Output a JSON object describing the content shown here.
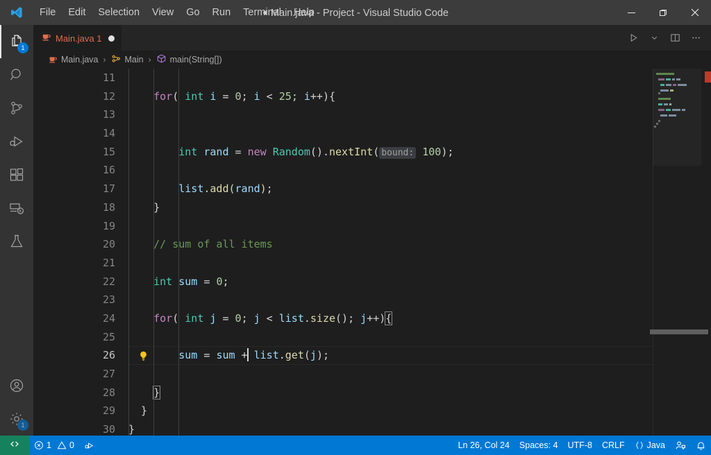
{
  "window": {
    "title": "Main.java - Project - Visual Studio Code",
    "dirty_marker": "●",
    "minimize_icon": "minimize-icon",
    "maximize_icon": "maximize-icon",
    "close_icon": "close-icon"
  },
  "menubar": {
    "items": [
      {
        "label": "File"
      },
      {
        "label": "Edit"
      },
      {
        "label": "Selection"
      },
      {
        "label": "View"
      },
      {
        "label": "Go"
      },
      {
        "label": "Run"
      },
      {
        "label": "Terminal"
      },
      {
        "label": "Help"
      }
    ]
  },
  "activitybar": {
    "items": [
      {
        "name": "explorer",
        "icon": "files-icon",
        "badge": "1",
        "active": true
      },
      {
        "name": "search",
        "icon": "search-icon",
        "badge": "",
        "active": false
      },
      {
        "name": "source-control",
        "icon": "source-control-icon",
        "badge": "",
        "active": false
      },
      {
        "name": "run-and-debug",
        "icon": "run-debug-icon",
        "badge": "",
        "active": false
      },
      {
        "name": "extensions",
        "icon": "extensions-icon",
        "badge": "",
        "active": false
      },
      {
        "name": "remote-explorer",
        "icon": "remote-explorer-icon",
        "badge": "",
        "active": false
      },
      {
        "name": "testing",
        "icon": "beaker-icon",
        "badge": "",
        "active": false
      },
      {
        "name": "accounts",
        "icon": "account-icon",
        "badge": "",
        "active": false
      },
      {
        "name": "settings",
        "icon": "gear-icon",
        "badge": "1",
        "active": false
      }
    ]
  },
  "tabs": {
    "open": [
      {
        "label": "Main.java 1",
        "icon": "java-file-icon",
        "dirty": true
      }
    ],
    "actions": [
      {
        "name": "run-code",
        "icon": "play-icon"
      },
      {
        "name": "run-options",
        "icon": "chevron-down-icon"
      },
      {
        "name": "split-editor",
        "icon": "split-editor-icon"
      },
      {
        "name": "more-actions",
        "icon": "ellipsis-icon"
      }
    ]
  },
  "breadcrumbs": {
    "parts": [
      {
        "label": "Main.java",
        "icon": "java-file-icon"
      },
      {
        "label": "Main",
        "icon": "class-icon"
      },
      {
        "label": "main(String[])",
        "icon": "method-icon"
      }
    ],
    "separator": "›"
  },
  "editor": {
    "language": "java",
    "first_visible_line": 11,
    "current_line": 26,
    "lines": [
      {
        "n": "11",
        "tokens": []
      },
      {
        "n": "12",
        "tokens": [
          {
            "t": "    ",
            "c": "pn"
          },
          {
            "t": "for",
            "c": "kw"
          },
          {
            "t": "( ",
            "c": "pn"
          },
          {
            "t": "int",
            "c": "type"
          },
          {
            "t": " ",
            "c": "pn"
          },
          {
            "t": "i",
            "c": "var"
          },
          {
            "t": " = ",
            "c": "pn"
          },
          {
            "t": "0",
            "c": "num"
          },
          {
            "t": "; ",
            "c": "pn"
          },
          {
            "t": "i",
            "c": "var"
          },
          {
            "t": " < ",
            "c": "pn"
          },
          {
            "t": "25",
            "c": "num"
          },
          {
            "t": "; ",
            "c": "pn"
          },
          {
            "t": "i",
            "c": "var"
          },
          {
            "t": "++){",
            "c": "pn"
          }
        ]
      },
      {
        "n": "13",
        "tokens": []
      },
      {
        "n": "14",
        "tokens": []
      },
      {
        "n": "15",
        "tokens": [
          {
            "t": "        ",
            "c": "pn"
          },
          {
            "t": "int",
            "c": "type"
          },
          {
            "t": " ",
            "c": "pn"
          },
          {
            "t": "rand",
            "c": "var"
          },
          {
            "t": " = ",
            "c": "pn"
          },
          {
            "t": "new",
            "c": "kw"
          },
          {
            "t": " ",
            "c": "pn"
          },
          {
            "t": "Random",
            "c": "type"
          },
          {
            "t": "().",
            "c": "pn"
          },
          {
            "t": "nextInt",
            "c": "fn"
          },
          {
            "t": "(",
            "c": "pn"
          },
          {
            "t": "bound:",
            "c": "hint"
          },
          {
            "t": " ",
            "c": "pn"
          },
          {
            "t": "100",
            "c": "num"
          },
          {
            "t": ");",
            "c": "pn"
          }
        ]
      },
      {
        "n": "16",
        "tokens": []
      },
      {
        "n": "17",
        "tokens": [
          {
            "t": "        ",
            "c": "pn"
          },
          {
            "t": "list",
            "c": "var"
          },
          {
            "t": ".",
            "c": "pn"
          },
          {
            "t": "add",
            "c": "fn"
          },
          {
            "t": "(",
            "c": "pn"
          },
          {
            "t": "rand",
            "c": "var"
          },
          {
            "t": ");",
            "c": "pn"
          }
        ]
      },
      {
        "n": "18",
        "tokens": [
          {
            "t": "    }",
            "c": "pn"
          }
        ]
      },
      {
        "n": "19",
        "tokens": []
      },
      {
        "n": "20",
        "tokens": [
          {
            "t": "    // sum of all items",
            "c": "cmt"
          }
        ]
      },
      {
        "n": "21",
        "tokens": []
      },
      {
        "n": "22",
        "tokens": [
          {
            "t": "    ",
            "c": "pn"
          },
          {
            "t": "int",
            "c": "type"
          },
          {
            "t": " ",
            "c": "pn"
          },
          {
            "t": "sum",
            "c": "var"
          },
          {
            "t": " = ",
            "c": "pn"
          },
          {
            "t": "0",
            "c": "num"
          },
          {
            "t": ";",
            "c": "pn"
          }
        ]
      },
      {
        "n": "23",
        "tokens": []
      },
      {
        "n": "24",
        "tokens": [
          {
            "t": "    ",
            "c": "pn"
          },
          {
            "t": "for",
            "c": "kw"
          },
          {
            "t": "( ",
            "c": "pn"
          },
          {
            "t": "int",
            "c": "type"
          },
          {
            "t": " ",
            "c": "pn"
          },
          {
            "t": "j",
            "c": "var"
          },
          {
            "t": " = ",
            "c": "pn"
          },
          {
            "t": "0",
            "c": "num"
          },
          {
            "t": "; ",
            "c": "pn"
          },
          {
            "t": "j",
            "c": "var"
          },
          {
            "t": " < ",
            "c": "pn"
          },
          {
            "t": "list",
            "c": "var"
          },
          {
            "t": ".",
            "c": "pn"
          },
          {
            "t": "size",
            "c": "fn"
          },
          {
            "t": "(); ",
            "c": "pn"
          },
          {
            "t": "j",
            "c": "var"
          },
          {
            "t": "++)",
            "c": "pn"
          },
          {
            "t": "{",
            "c": "pn bracket-match"
          }
        ]
      },
      {
        "n": "25",
        "tokens": []
      },
      {
        "n": "26",
        "tokens": [
          {
            "t": "        ",
            "c": "pn"
          },
          {
            "t": "sum",
            "c": "var"
          },
          {
            "t": " = ",
            "c": "pn"
          },
          {
            "t": "sum",
            "c": "var"
          },
          {
            "t": " +",
            "c": "pn"
          },
          {
            "t": "__CURSOR__",
            "c": "cursor"
          },
          {
            "t": " ",
            "c": "pn"
          },
          {
            "t": "list",
            "c": "var"
          },
          {
            "t": ".",
            "c": "pn"
          },
          {
            "t": "get",
            "c": "fn"
          },
          {
            "t": "(",
            "c": "pn"
          },
          {
            "t": "j",
            "c": "var"
          },
          {
            "t": ");",
            "c": "pn"
          }
        ]
      },
      {
        "n": "27",
        "tokens": []
      },
      {
        "n": "28",
        "tokens": [
          {
            "t": "    ",
            "c": "pn"
          },
          {
            "t": "}",
            "c": "pn bracket-match"
          }
        ]
      },
      {
        "n": "29",
        "tokens": [
          {
            "t": "  }",
            "c": "pn"
          }
        ]
      },
      {
        "n": "30",
        "tokens": [
          {
            "t": "}",
            "c": "pn"
          }
        ]
      }
    ],
    "lightbulb": {
      "line": 26,
      "icon": "lightbulb-icon"
    }
  },
  "minimap": {
    "rows": [
      {
        "indent": 1,
        "segs": [
          {
            "w": 26,
            "color": "#6a9955"
          }
        ]
      },
      {
        "indent": 0,
        "segs": []
      },
      {
        "indent": 2,
        "segs": [
          {
            "w": 9,
            "color": "#9b6fa0"
          },
          {
            "w": 7,
            "color": "#4ec9b0"
          },
          {
            "w": 4,
            "color": "#8aa0b5"
          },
          {
            "w": 6,
            "color": "#8aa0b5"
          }
        ]
      },
      {
        "indent": 0,
        "segs": []
      },
      {
        "indent": 3,
        "segs": [
          {
            "w": 6,
            "color": "#4ec9b0"
          },
          {
            "w": 8,
            "color": "#8aa0b5"
          },
          {
            "w": 5,
            "color": "#9b6fa0"
          },
          {
            "w": 13,
            "color": "#8aa0b5"
          }
        ]
      },
      {
        "indent": 0,
        "segs": []
      },
      {
        "indent": 3,
        "segs": [
          {
            "w": 12,
            "color": "#8aa0b5"
          },
          {
            "w": 5,
            "color": "#c4c48b"
          }
        ]
      },
      {
        "indent": 2,
        "segs": [
          {
            "w": 3,
            "color": "#777777"
          }
        ]
      },
      {
        "indent": 0,
        "segs": []
      },
      {
        "indent": 2,
        "segs": [
          {
            "w": 18,
            "color": "#6a9955"
          }
        ]
      },
      {
        "indent": 0,
        "segs": []
      },
      {
        "indent": 2,
        "segs": [
          {
            "w": 6,
            "color": "#4ec9b0"
          },
          {
            "w": 6,
            "color": "#8aa0b5"
          },
          {
            "w": 3,
            "color": "#b5cea8"
          }
        ]
      },
      {
        "indent": 0,
        "segs": []
      },
      {
        "indent": 2,
        "segs": [
          {
            "w": 9,
            "color": "#9b6fa0"
          },
          {
            "w": 7,
            "color": "#4ec9b0"
          },
          {
            "w": 12,
            "color": "#8aa0b5"
          },
          {
            "w": 5,
            "color": "#8aa0b5"
          }
        ]
      },
      {
        "indent": 0,
        "segs": []
      },
      {
        "indent": 3,
        "segs": [
          {
            "w": 10,
            "color": "#8aa0b5"
          },
          {
            "w": 11,
            "color": "#8aa0b5"
          }
        ]
      },
      {
        "indent": 0,
        "segs": []
      },
      {
        "indent": 2,
        "segs": [
          {
            "w": 3,
            "color": "#777777"
          }
        ]
      },
      {
        "indent": 1,
        "segs": [
          {
            "w": 3,
            "color": "#777777"
          }
        ]
      },
      {
        "indent": 0,
        "segs": [
          {
            "w": 3,
            "color": "#777777"
          }
        ]
      }
    ],
    "error_marker_color": "#c0392b"
  },
  "statusbar": {
    "remote_icon": "remote-window-icon",
    "left": [
      {
        "name": "problems",
        "icon": "error-icon",
        "errors": "1",
        "warn_icon": "warning-icon",
        "warnings": "0"
      },
      {
        "name": "run-task",
        "icon": "debug-task-icon"
      }
    ],
    "right": [
      {
        "name": "editor-position",
        "label": "Ln 26, Col 24"
      },
      {
        "name": "editor-indentation",
        "label": "Spaces: 4"
      },
      {
        "name": "editor-encoding",
        "label": "UTF-8"
      },
      {
        "name": "editor-eol",
        "label": "CRLF"
      },
      {
        "name": "editor-language",
        "label": "Java",
        "icon": "braces-icon"
      },
      {
        "name": "feedback",
        "icon": "feedback-icon"
      },
      {
        "name": "notifications",
        "icon": "bell-icon"
      }
    ]
  },
  "colors": {
    "titlebar_bg": "#3c3c3c",
    "activitybar_bg": "#333333",
    "editor_bg": "#1e1e1e",
    "tabbar_bg": "#252526",
    "statusbar_bg": "#0078d4",
    "remote_bg": "#16825d",
    "badge_bg": "#0078d4",
    "tab_active_fg": "#e06c4b"
  }
}
